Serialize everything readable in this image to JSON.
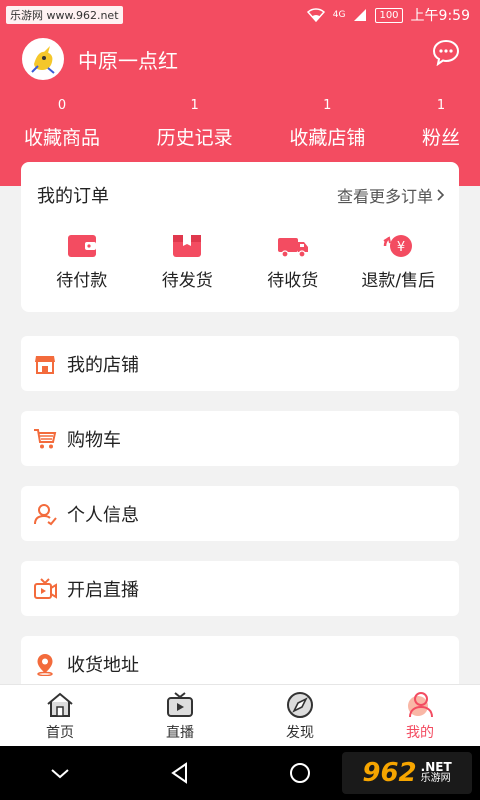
{
  "status_bar": {
    "watermark": "乐游网 www.962.net",
    "network": "4G",
    "battery": "100",
    "time": "上午9:59"
  },
  "profile": {
    "username": "中原一点红",
    "avatar_icon": "cartoon-avatar-icon",
    "message_icon": "chat-bubble-icon"
  },
  "stats": [
    {
      "count": "0",
      "label": "收藏商品"
    },
    {
      "count": "1",
      "label": "历史记录"
    },
    {
      "count": "1",
      "label": "收藏店铺"
    },
    {
      "count": "1",
      "label": "粉丝"
    }
  ],
  "orders": {
    "title": "我的订单",
    "more": "查看更多订单",
    "items": [
      {
        "label": "待付款",
        "icon": "wallet-icon"
      },
      {
        "label": "待发货",
        "icon": "box-icon"
      },
      {
        "label": "待收货",
        "icon": "truck-icon"
      },
      {
        "label": "退款/售后",
        "icon": "refund-icon"
      }
    ]
  },
  "menu": [
    {
      "label": "我的店铺",
      "icon": "shop-icon"
    },
    {
      "label": "购物车",
      "icon": "cart-icon"
    },
    {
      "label": "个人信息",
      "icon": "user-icon"
    },
    {
      "label": "开启直播",
      "icon": "live-camera-icon"
    },
    {
      "label": "收货地址",
      "icon": "location-pin-icon"
    }
  ],
  "tabs": [
    {
      "label": "首页",
      "icon": "home-icon"
    },
    {
      "label": "直播",
      "icon": "tv-icon"
    },
    {
      "label": "发现",
      "icon": "compass-icon"
    },
    {
      "label": "我的",
      "icon": "profile-icon",
      "active": true
    }
  ],
  "brand_logo": {
    "number": "962",
    "net": ".NET",
    "site": "乐游网"
  },
  "colors": {
    "accent": "#f34c61",
    "icon_orange": "#f36b3c"
  }
}
